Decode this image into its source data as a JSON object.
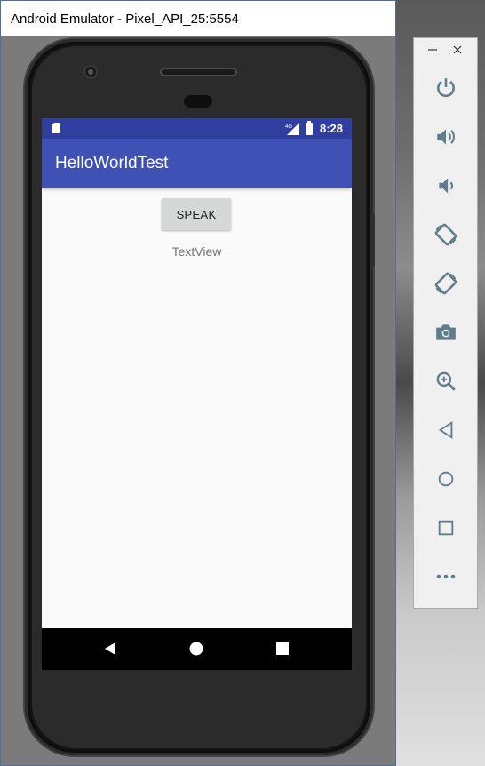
{
  "window": {
    "title": "Android Emulator - Pixel_API_25:5554"
  },
  "status_bar": {
    "time": "8:28",
    "network": "4G",
    "accent": "#303f9f"
  },
  "app_bar": {
    "title": "HelloWorldTest",
    "color": "#3f51b5"
  },
  "content": {
    "button_label": "SPEAK",
    "text_view": "TextView"
  },
  "nav_bar": {
    "buttons": [
      "back-icon",
      "home-icon",
      "recents-icon"
    ]
  },
  "toolbar": {
    "window_controls": [
      "minimize-icon",
      "close-icon"
    ],
    "buttons": [
      "power-icon",
      "volume-up-icon",
      "volume-down-icon",
      "rotate-left-icon",
      "rotate-right-icon",
      "camera-icon",
      "zoom-icon",
      "back-icon",
      "home-icon",
      "overview-icon",
      "more-icon"
    ],
    "icon_color": "#607d8b"
  }
}
